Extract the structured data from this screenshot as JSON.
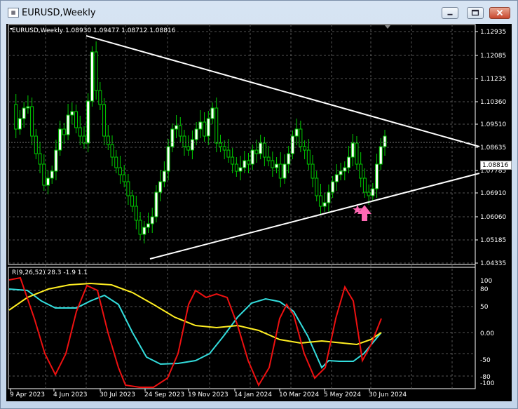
{
  "window": {
    "title": "EURUSD,Weekly",
    "icon": "chart-window-icon"
  },
  "chart": {
    "header": "EURUSD,Weekly  1.08930 1.09477 1.08712 1.08816",
    "current_price": "1.08816",
    "price_labels": [
      "1.12935",
      "1.12085",
      "1.11235",
      "1.10360",
      "1.09510",
      "1.08635",
      "1.07785",
      "1.06910",
      "1.06060",
      "1.05185",
      "1.04335"
    ],
    "indicator_header": "R(9,26,52) 28.3 -1.9 1.1",
    "indicator_labels": [
      "100",
      "80",
      "50",
      "0.00",
      "-50",
      "-80",
      "-100"
    ],
    "date_labels": [
      "9 Apr 2023",
      "4 Jun 2023",
      "30 Jul 2023",
      "24 Sep 2023",
      "19 Nov 2023",
      "14 Jan 2024",
      "10 Mar 2024",
      "5 May 2024",
      "30 Jun 2024"
    ],
    "colors": {
      "background": "#000000",
      "candle": "#00cc00",
      "bull_body": "#ffffff",
      "trendline": "#ffffff",
      "red_line": "#ee1111",
      "yellow_line": "#ffee22",
      "cyan_line": "#33dddd",
      "marker": "#ff69b4"
    },
    "marker_icons": [
      "star-icon",
      "up-arrow-icon"
    ]
  }
}
